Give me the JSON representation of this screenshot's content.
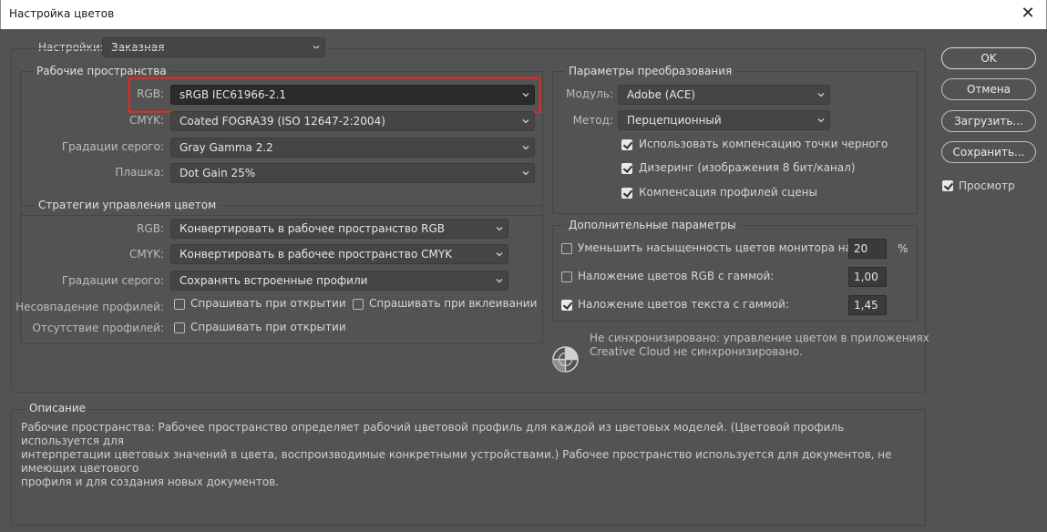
{
  "window": {
    "title": "Настройка цветов",
    "close_glyph": "✕"
  },
  "settings": {
    "label": "Настройки:",
    "value": "Заказная"
  },
  "working_spaces": {
    "title": "Рабочие пространства",
    "rgb_label": "RGB:",
    "rgb_value": "sRGB IEC61966-2.1",
    "cmyk_label": "CMYK:",
    "cmyk_value": "Coated FOGRA39 (ISO 12647-2:2004)",
    "gray_label": "Градации серого:",
    "gray_value": "Gray Gamma 2.2",
    "spot_label": "Плашка:",
    "spot_value": "Dot Gain 25%"
  },
  "policies": {
    "title": "Стратегии управления цветом",
    "rgb_label": "RGB:",
    "rgb_value": "Конвертировать в рабочее пространство RGB",
    "cmyk_label": "CMYK:",
    "cmyk_value": "Конвертировать в рабочее пространство CMYK",
    "gray_label": "Градации серого:",
    "gray_value": "Сохранять встроенные профили",
    "mismatch_label": "Несовпадение профилей:",
    "mismatch_open": {
      "label": "Спрашивать при открытии",
      "checked": false
    },
    "mismatch_paste": {
      "label": "Спрашивать при вклеивании",
      "checked": false
    },
    "missing_label": "Отсутствие профилей:",
    "missing_open": {
      "label": "Спрашивать при открытии",
      "checked": false
    }
  },
  "conversion": {
    "title": "Параметры преобразования",
    "engine_label": "Модуль:",
    "engine_value": "Adobe (ACE)",
    "intent_label": "Метод:",
    "intent_value": "Перцепционный",
    "bpc": {
      "label": "Использовать компенсацию точки черного",
      "checked": true
    },
    "dither": {
      "label": "Дизеринг (изображения 8 бит/канал)",
      "checked": true
    },
    "scene": {
      "label": "Компенсация профилей сцены",
      "checked": true
    }
  },
  "advanced": {
    "title": "Дополнительные параметры",
    "desaturate": {
      "label": "Уменьшить насыщенность цветов монитора на:",
      "checked": false,
      "value": "20",
      "unit": "%"
    },
    "blend_rgb": {
      "label": "Наложение цветов RGB с гаммой:",
      "checked": false,
      "value": "1,00"
    },
    "blend_text": {
      "label": "Наложение цветов текста с гаммой:",
      "checked": true,
      "value": "1,45"
    }
  },
  "sync": {
    "line1": "Не синхронизировано: управление цветом в приложениях",
    "line2": "Creative Cloud не синхронизировано.",
    "icon": "sync-status-icon"
  },
  "description": {
    "title": "Описание",
    "line1": "Рабочие пространства:  Рабочее пространство определяет рабочий цветовой профиль для каждой из цветовых моделей.  (Цветовой профиль используется для",
    "line2": "интерпретации цветовых значений в цвета, воспроизводимые конкретными устройствами.)  Рабочее пространство используется для документов, не имеющих цветового",
    "line3": "профиля и для создания новых документов."
  },
  "buttons": {
    "ok": "OK",
    "cancel": "Отмена",
    "load": "Загрузить...",
    "save": "Сохранить..."
  },
  "preview": {
    "label": "Просмотр",
    "checked": true
  },
  "colors": {
    "highlight": "#e8251f",
    "background": "#535353"
  }
}
